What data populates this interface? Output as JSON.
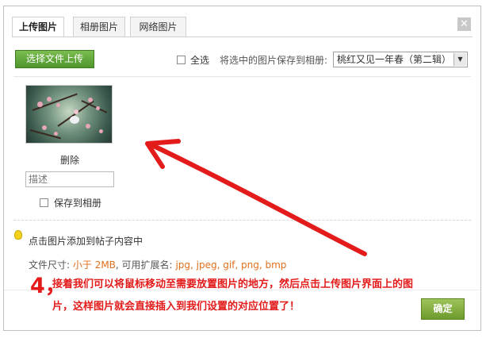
{
  "tabs": [
    {
      "label": "上传图片",
      "active": true
    },
    {
      "label": "相册图片",
      "active": false
    },
    {
      "label": "网络图片",
      "active": false
    }
  ],
  "close_icon": "close-icon",
  "toolbar": {
    "upload_label": "选择文件上传",
    "select_all_label": "全选",
    "select_all_checked": false,
    "save_selected_label": "将选中的图片保存到相册:",
    "album_selected": "桃红又见一年春（第二辑）"
  },
  "photo": {
    "delete_label": "删除",
    "description_placeholder": "描述",
    "save_to_album_label": "保存到相册",
    "save_to_album_checked": false
  },
  "tip": {
    "icon": "lightbulb-icon",
    "text": "点击图片添加到帖子内容中"
  },
  "file_info": {
    "size_label": "文件尺寸:",
    "size_value": "小于 2MB",
    "ext_label": ", 可用扩展名:",
    "ext_value": "jpg, jpeg, gif, png, bmp"
  },
  "annotation": {
    "number": "4，",
    "text": "接着我们可以将鼠标移动至需要放置图片的地方，然后点击上传图片界面上的图片，这样图片就会直接插入到我们设置的对应位置了！",
    "color": "#e31b1b"
  },
  "footer": {
    "ok_label": "确定"
  },
  "colors": {
    "upload_button": "#5ea53a",
    "ok_button": "#7fae3e",
    "highlight_orange": "#e0701c"
  }
}
